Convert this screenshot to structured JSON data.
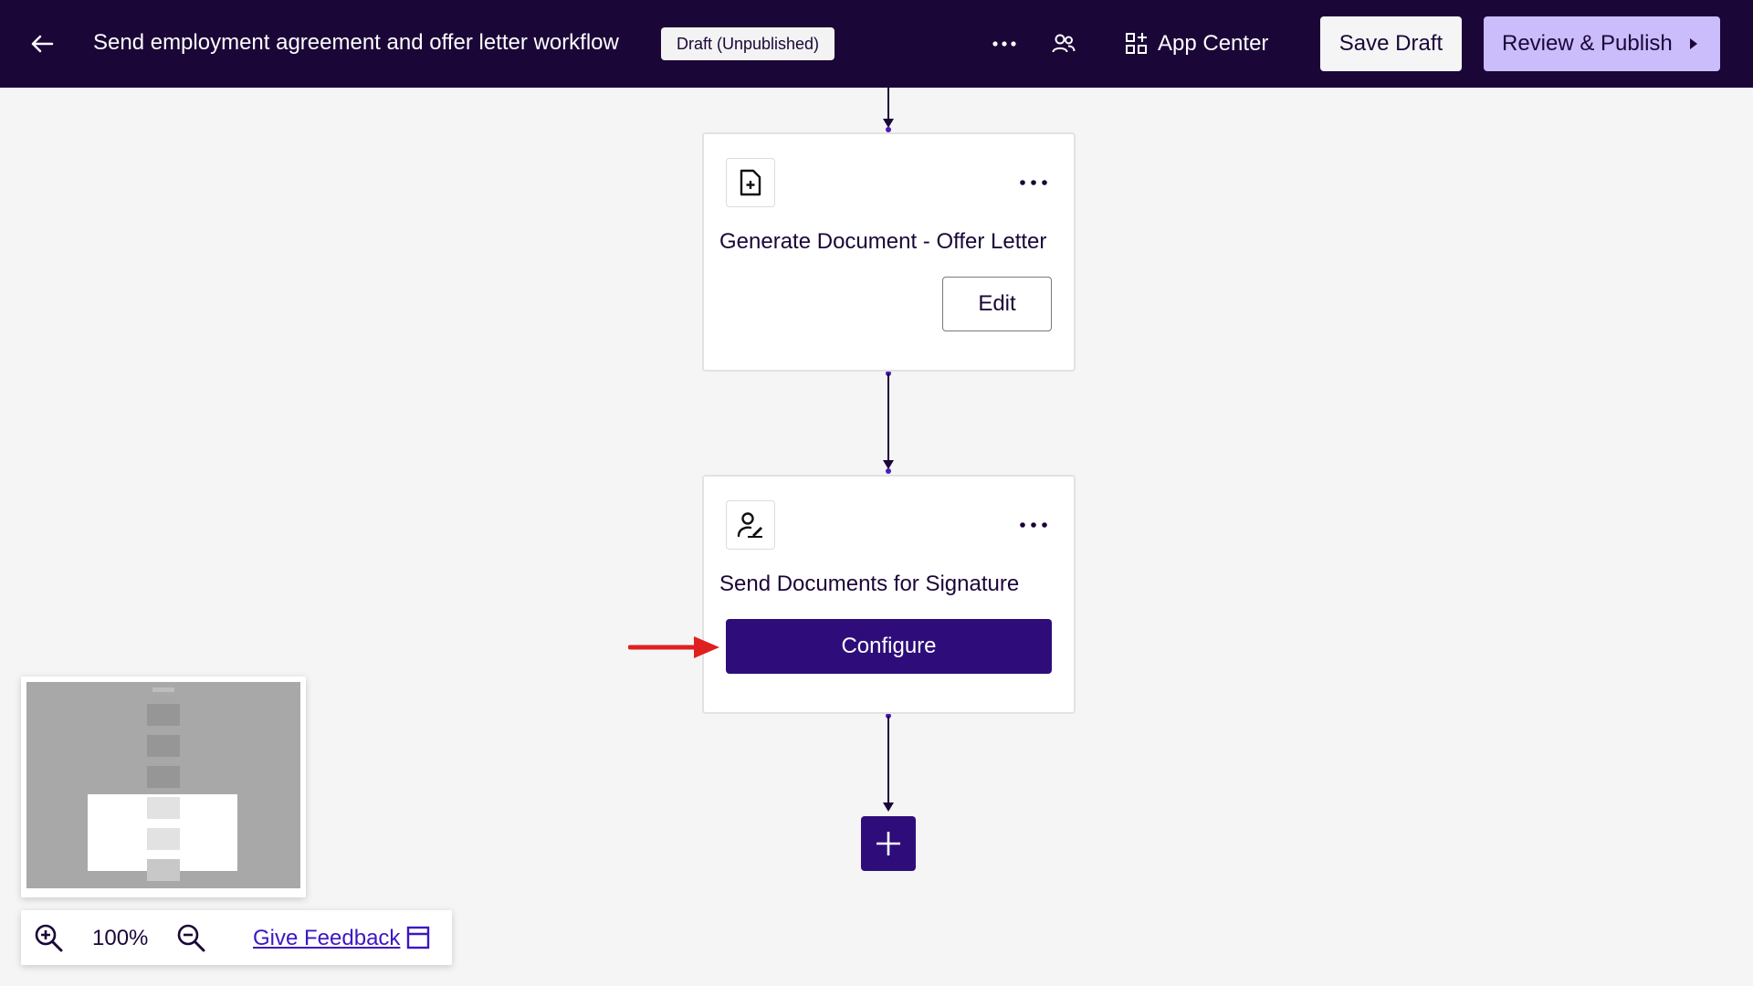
{
  "header": {
    "back_icon": "arrow-left-icon",
    "title": "Send employment agreement and offer letter workflow",
    "status_badge": "Draft (Unpublished)",
    "more_icon": "more-horizontal-icon",
    "collaborators_icon": "users-icon",
    "app_center_icon": "app-grid-icon",
    "app_center_label": "App Center",
    "save_draft_label": "Save Draft",
    "publish_label": "Review & Publish",
    "publish_icon": "caret-right-icon"
  },
  "steps": [
    {
      "icon": "document-add-icon",
      "title": "Generate Document - Offer Letter",
      "action_label": "Edit",
      "more_icon": "more-horizontal-icon"
    },
    {
      "icon": "user-signature-icon",
      "title": "Send Documents for Signature",
      "action_label": "Configure",
      "more_icon": "more-horizontal-icon"
    }
  ],
  "add_step_icon": "plus-icon",
  "zoom": {
    "zoom_in_icon": "zoom-in-icon",
    "level": "100%",
    "zoom_out_icon": "zoom-out-icon",
    "feedback_label": "Give Feedback",
    "feedback_icon": "feedback-window-icon"
  },
  "colors": {
    "header_bg": "#1b0638",
    "primary": "#2e0d7a",
    "publish_bg": "#cbbcfc",
    "link": "#3d17c2",
    "annotation_arrow": "#e02020"
  }
}
